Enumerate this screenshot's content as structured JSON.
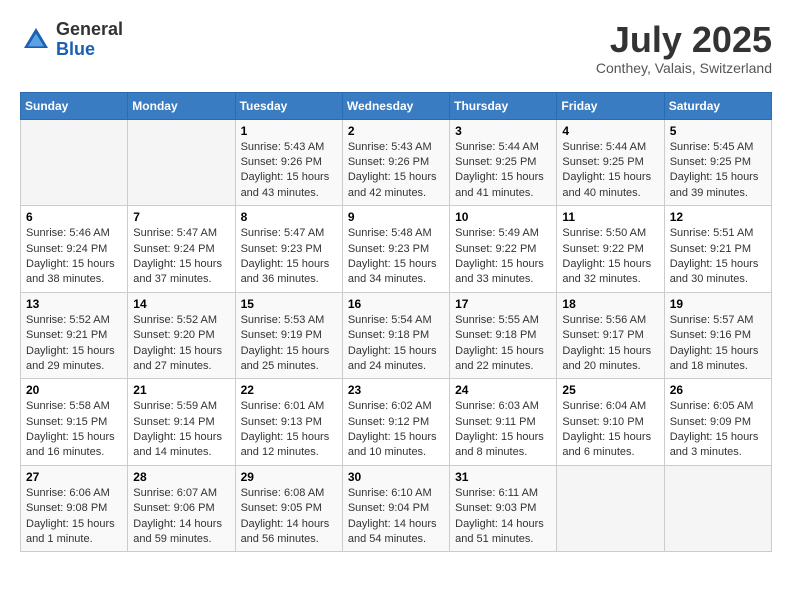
{
  "header": {
    "logo_line1": "General",
    "logo_line2": "Blue",
    "month": "July 2025",
    "location": "Conthey, Valais, Switzerland"
  },
  "weekdays": [
    "Sunday",
    "Monday",
    "Tuesday",
    "Wednesday",
    "Thursday",
    "Friday",
    "Saturday"
  ],
  "weeks": [
    [
      {
        "day": "",
        "info": ""
      },
      {
        "day": "",
        "info": ""
      },
      {
        "day": "1",
        "info": "Sunrise: 5:43 AM\nSunset: 9:26 PM\nDaylight: 15 hours and 43 minutes."
      },
      {
        "day": "2",
        "info": "Sunrise: 5:43 AM\nSunset: 9:26 PM\nDaylight: 15 hours and 42 minutes."
      },
      {
        "day": "3",
        "info": "Sunrise: 5:44 AM\nSunset: 9:25 PM\nDaylight: 15 hours and 41 minutes."
      },
      {
        "day": "4",
        "info": "Sunrise: 5:44 AM\nSunset: 9:25 PM\nDaylight: 15 hours and 40 minutes."
      },
      {
        "day": "5",
        "info": "Sunrise: 5:45 AM\nSunset: 9:25 PM\nDaylight: 15 hours and 39 minutes."
      }
    ],
    [
      {
        "day": "6",
        "info": "Sunrise: 5:46 AM\nSunset: 9:24 PM\nDaylight: 15 hours and 38 minutes."
      },
      {
        "day": "7",
        "info": "Sunrise: 5:47 AM\nSunset: 9:24 PM\nDaylight: 15 hours and 37 minutes."
      },
      {
        "day": "8",
        "info": "Sunrise: 5:47 AM\nSunset: 9:23 PM\nDaylight: 15 hours and 36 minutes."
      },
      {
        "day": "9",
        "info": "Sunrise: 5:48 AM\nSunset: 9:23 PM\nDaylight: 15 hours and 34 minutes."
      },
      {
        "day": "10",
        "info": "Sunrise: 5:49 AM\nSunset: 9:22 PM\nDaylight: 15 hours and 33 minutes."
      },
      {
        "day": "11",
        "info": "Sunrise: 5:50 AM\nSunset: 9:22 PM\nDaylight: 15 hours and 32 minutes."
      },
      {
        "day": "12",
        "info": "Sunrise: 5:51 AM\nSunset: 9:21 PM\nDaylight: 15 hours and 30 minutes."
      }
    ],
    [
      {
        "day": "13",
        "info": "Sunrise: 5:52 AM\nSunset: 9:21 PM\nDaylight: 15 hours and 29 minutes."
      },
      {
        "day": "14",
        "info": "Sunrise: 5:52 AM\nSunset: 9:20 PM\nDaylight: 15 hours and 27 minutes."
      },
      {
        "day": "15",
        "info": "Sunrise: 5:53 AM\nSunset: 9:19 PM\nDaylight: 15 hours and 25 minutes."
      },
      {
        "day": "16",
        "info": "Sunrise: 5:54 AM\nSunset: 9:18 PM\nDaylight: 15 hours and 24 minutes."
      },
      {
        "day": "17",
        "info": "Sunrise: 5:55 AM\nSunset: 9:18 PM\nDaylight: 15 hours and 22 minutes."
      },
      {
        "day": "18",
        "info": "Sunrise: 5:56 AM\nSunset: 9:17 PM\nDaylight: 15 hours and 20 minutes."
      },
      {
        "day": "19",
        "info": "Sunrise: 5:57 AM\nSunset: 9:16 PM\nDaylight: 15 hours and 18 minutes."
      }
    ],
    [
      {
        "day": "20",
        "info": "Sunrise: 5:58 AM\nSunset: 9:15 PM\nDaylight: 15 hours and 16 minutes."
      },
      {
        "day": "21",
        "info": "Sunrise: 5:59 AM\nSunset: 9:14 PM\nDaylight: 15 hours and 14 minutes."
      },
      {
        "day": "22",
        "info": "Sunrise: 6:01 AM\nSunset: 9:13 PM\nDaylight: 15 hours and 12 minutes."
      },
      {
        "day": "23",
        "info": "Sunrise: 6:02 AM\nSunset: 9:12 PM\nDaylight: 15 hours and 10 minutes."
      },
      {
        "day": "24",
        "info": "Sunrise: 6:03 AM\nSunset: 9:11 PM\nDaylight: 15 hours and 8 minutes."
      },
      {
        "day": "25",
        "info": "Sunrise: 6:04 AM\nSunset: 9:10 PM\nDaylight: 15 hours and 6 minutes."
      },
      {
        "day": "26",
        "info": "Sunrise: 6:05 AM\nSunset: 9:09 PM\nDaylight: 15 hours and 3 minutes."
      }
    ],
    [
      {
        "day": "27",
        "info": "Sunrise: 6:06 AM\nSunset: 9:08 PM\nDaylight: 15 hours and 1 minute."
      },
      {
        "day": "28",
        "info": "Sunrise: 6:07 AM\nSunset: 9:06 PM\nDaylight: 14 hours and 59 minutes."
      },
      {
        "day": "29",
        "info": "Sunrise: 6:08 AM\nSunset: 9:05 PM\nDaylight: 14 hours and 56 minutes."
      },
      {
        "day": "30",
        "info": "Sunrise: 6:10 AM\nSunset: 9:04 PM\nDaylight: 14 hours and 54 minutes."
      },
      {
        "day": "31",
        "info": "Sunrise: 6:11 AM\nSunset: 9:03 PM\nDaylight: 14 hours and 51 minutes."
      },
      {
        "day": "",
        "info": ""
      },
      {
        "day": "",
        "info": ""
      }
    ]
  ]
}
